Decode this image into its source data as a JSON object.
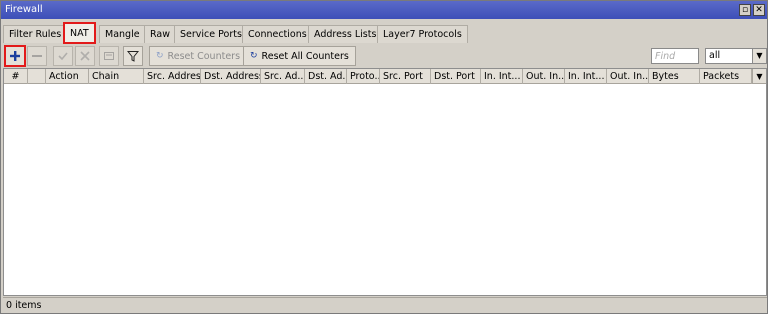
{
  "window": {
    "title": "Firewall",
    "restore_glyph": "▫",
    "close_glyph": "✕"
  },
  "tabs": [
    {
      "label": "Filter Rules",
      "active": false
    },
    {
      "label": "NAT",
      "active": true
    },
    {
      "label": "Mangle",
      "active": false
    },
    {
      "label": "Raw",
      "active": false
    },
    {
      "label": "Service Ports",
      "active": false
    },
    {
      "label": "Connections",
      "active": false
    },
    {
      "label": "Address Lists",
      "active": false
    },
    {
      "label": "Layer7 Protocols",
      "active": false
    }
  ],
  "toolbar": {
    "add_icon": "plus-icon",
    "remove_icon": "minus-icon",
    "enable_icon": "check-icon",
    "disable_icon": "x-icon",
    "comment_icon": "comment-icon",
    "filter_icon": "funnel-icon",
    "reset_counters_label": "Reset Counters",
    "reset_all_counters_label": "Reset All Counters",
    "find_placeholder": "Find",
    "filter_select_value": "all"
  },
  "table": {
    "columns": [
      "#",
      "",
      "Action",
      "Chain",
      "Src. Address",
      "Dst. Address",
      "Src. Ad...",
      "Dst. Ad...",
      "Proto...",
      "Src. Port",
      "Dst. Port",
      "In. Int...",
      "Out. In...",
      "In. Int...",
      "Out. In...",
      "Bytes",
      "Packets"
    ],
    "rows": []
  },
  "status": {
    "item_count": "0 items"
  },
  "colors": {
    "titlebar": "#3d4fb8",
    "highlight": "#e21a1a",
    "add_blue": "#1c3f9e"
  }
}
